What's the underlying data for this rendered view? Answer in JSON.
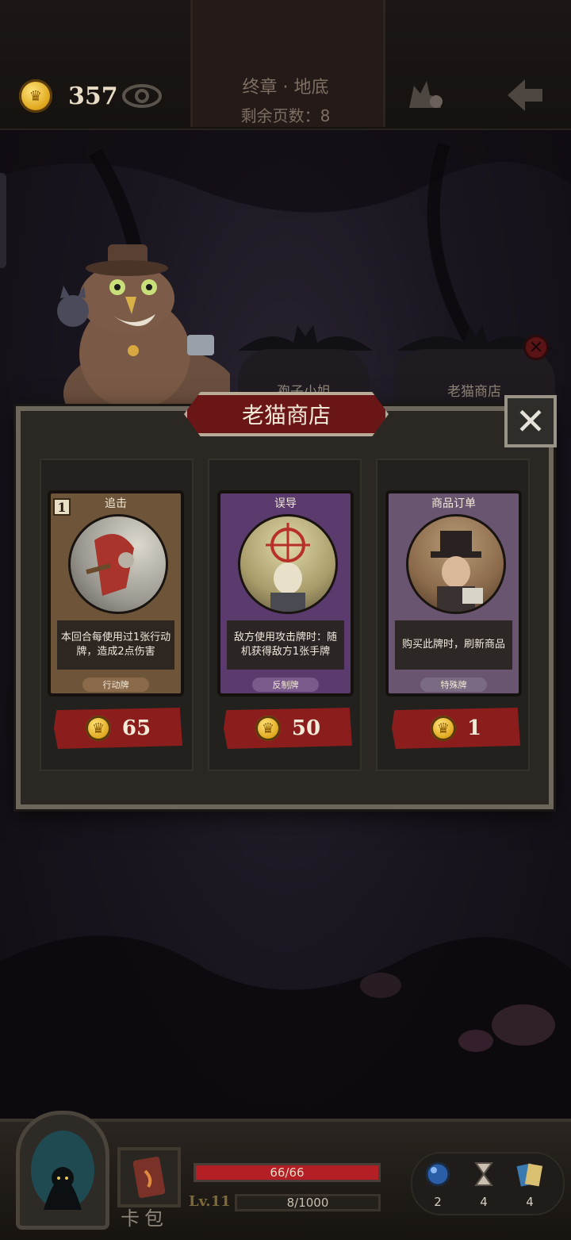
{
  "header": {
    "gold": "357",
    "chapter_title": "终章 · 地底",
    "pages_left": "剩余页数：8"
  },
  "icons": {
    "gold": "crown-coin-icon",
    "vision": "eye-icon",
    "companion": "cat-silhouette-icon",
    "back": "back-arrow-icon",
    "close": "close-x-icon",
    "orb": "blue-orb-icon",
    "hourglass": "hourglass-icon",
    "cards": "cards-icon"
  },
  "npc_tabs": {
    "left": "孢子小姐",
    "right": "老猫商店"
  },
  "shop": {
    "title": "老猫商店",
    "items": [
      {
        "name": "追击",
        "cost": "1",
        "description": "本回合每使用过1张行动牌，造成2点伤害",
        "type": "行动牌",
        "price": "65",
        "theme": "#6e5539"
      },
      {
        "name": "误导",
        "description": "敌方使用攻击牌时：随机获得敌方1张手牌",
        "type": "反制牌",
        "price": "50",
        "theme": "#5b3b6e"
      },
      {
        "name": "商品订单",
        "description": "购买此牌时，刷新商品",
        "type": "特殊牌",
        "price": "1",
        "theme": "#6a5570"
      }
    ]
  },
  "player": {
    "hp": "66/66",
    "hp_fraction": 1.0,
    "level": "Lv.11",
    "xp": "8/1000",
    "card_bag_label": "卡包",
    "resources": [
      {
        "icon": "blue-orb-icon",
        "count": "2"
      },
      {
        "icon": "hourglass-icon",
        "count": "4"
      },
      {
        "icon": "cards-icon",
        "count": "4"
      }
    ]
  },
  "colors": {
    "price_red": "#8b1d1c",
    "hp_red": "#b31f24",
    "gold": "#e0a91f"
  }
}
